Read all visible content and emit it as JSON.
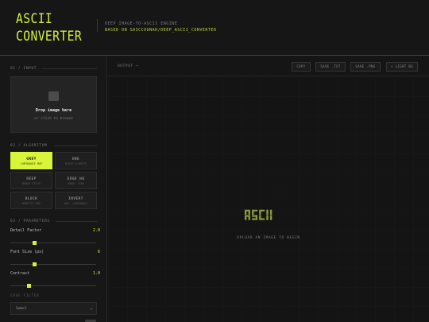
{
  "header": {
    "logo_line1": "ASCII",
    "logo_line2": "CONVERTER",
    "tagline_line1": "DEEP IMAGE-TO-ASCII ENGINE",
    "tagline_line2": "BASED ON SAICCOUNAR/DEEP_ASCII_CONVERTER"
  },
  "sidebar": {
    "input_title": "01 / INPUT",
    "dropzone_title": "Drop image here",
    "dropzone_sub": "or click to browse",
    "algorithm_title": "02 / ALGORITHM",
    "algorithms": [
      {
        "name": "GREY",
        "desc": "LUMINANCE MAP",
        "active": true
      },
      {
        "name": "ONE",
        "desc": "BLACK & WHITE",
        "active": false
      },
      {
        "name": "DEEP",
        "desc": "DENSE STYLE",
        "active": false
      },
      {
        "name": "EDGE HQ",
        "desc": "SOBEL FINE",
        "active": false
      },
      {
        "name": "BLOCK",
        "desc": "DENSITY MAP",
        "active": false
      },
      {
        "name": "INVERT",
        "desc": "NEG. LUMINANCE",
        "active": false
      }
    ],
    "parameters_title": "03 / PARAMETERS",
    "params": [
      {
        "label": "Detail Factor",
        "value": "2.0",
        "fraction": 0.28
      },
      {
        "label": "Font Size (px)",
        "value": "6",
        "fraction": 0.28
      },
      {
        "label": "Contrast",
        "value": "1.0",
        "fraction": 0.22
      }
    ],
    "edge_filter_title": "EDGE FILTER",
    "edge_filter_value": "Sobel"
  },
  "main": {
    "output_label": "OUTPUT →",
    "buttons": [
      "COPY",
      "SAVE .TXT",
      "SAVE .PNG",
      "☀ LIGHT BG"
    ],
    "empty_message": "UPLOAD AN IMAGE TO BEGIN"
  },
  "colors": {
    "accent": "#d8f53a",
    "background": "#141414",
    "panel": "#171717"
  }
}
